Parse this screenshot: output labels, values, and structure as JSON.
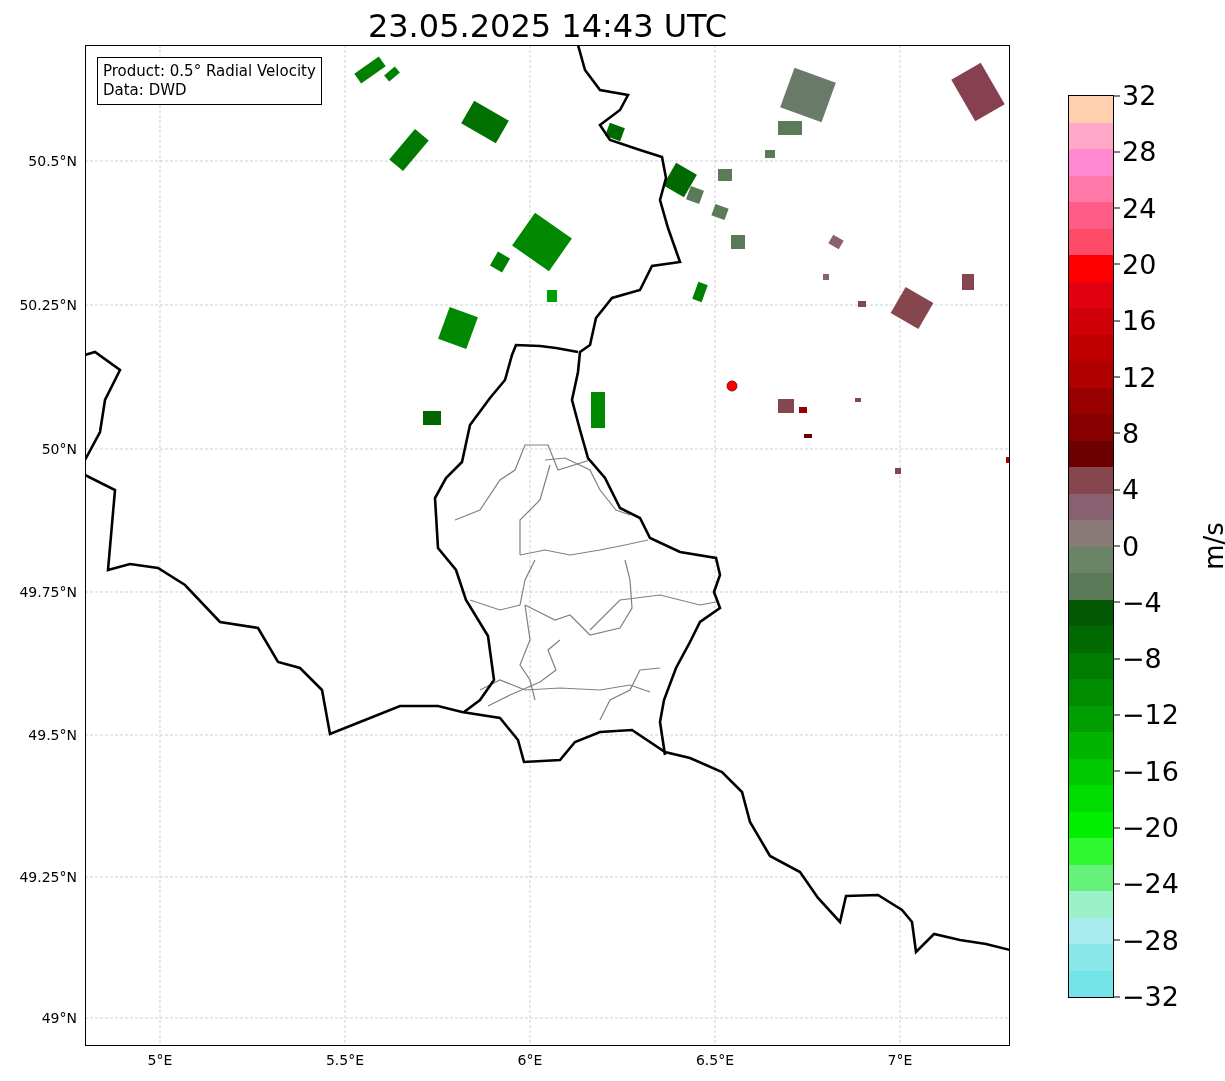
{
  "title": "23.05.2025 14:43 UTC",
  "legend": {
    "lines": [
      "Product: 0.5° Radial Velocity",
      "Data: DWD"
    ]
  },
  "map": {
    "lat_ticks": [
      "50.5°N",
      "50.25°N",
      "50°N",
      "49.75°N",
      "49.5°N",
      "49.25°N",
      "49°N"
    ],
    "lon_ticks": [
      "5°E",
      "5.5°E",
      "6°E",
      "6.5°E",
      "7°E"
    ]
  },
  "colorbar": {
    "label": "m/s",
    "ticks": [
      "32",
      "28",
      "24",
      "20",
      "16",
      "12",
      "8",
      "4",
      "0",
      "−4",
      "−8",
      "−12",
      "−16",
      "−20",
      "−24",
      "−28",
      "−32"
    ],
    "segments": [
      {
        "color": "#ffcfb0"
      },
      {
        "color": "#ffa8c8"
      },
      {
        "color": "#ff88d0"
      },
      {
        "color": "#ff78a8"
      },
      {
        "color": "#ff5c88"
      },
      {
        "color": "#ff4a68"
      },
      {
        "color": "#ff0000"
      },
      {
        "color": "#e00010"
      },
      {
        "color": "#d00008"
      },
      {
        "color": "#c00000"
      },
      {
        "color": "#b00000"
      },
      {
        "color": "#980000"
      },
      {
        "color": "#860000"
      },
      {
        "color": "#6c0000"
      },
      {
        "color": "#86464e"
      },
      {
        "color": "#886070"
      },
      {
        "color": "#8a7a78"
      },
      {
        "color": "#6a8468"
      },
      {
        "color": "#5a7a58"
      },
      {
        "color": "#045804"
      },
      {
        "color": "#006a00"
      },
      {
        "color": "#007c00"
      },
      {
        "color": "#008c00"
      },
      {
        "color": "#009e00"
      },
      {
        "color": "#00b400"
      },
      {
        "color": "#00c800"
      },
      {
        "color": "#00dc00"
      },
      {
        "color": "#00f000"
      },
      {
        "color": "#30f830"
      },
      {
        "color": "#66f27a"
      },
      {
        "color": "#9cf2c8"
      },
      {
        "color": "#a8eaee"
      },
      {
        "color": "#8ae8ea"
      },
      {
        "color": "#73e3e8"
      }
    ]
  }
}
